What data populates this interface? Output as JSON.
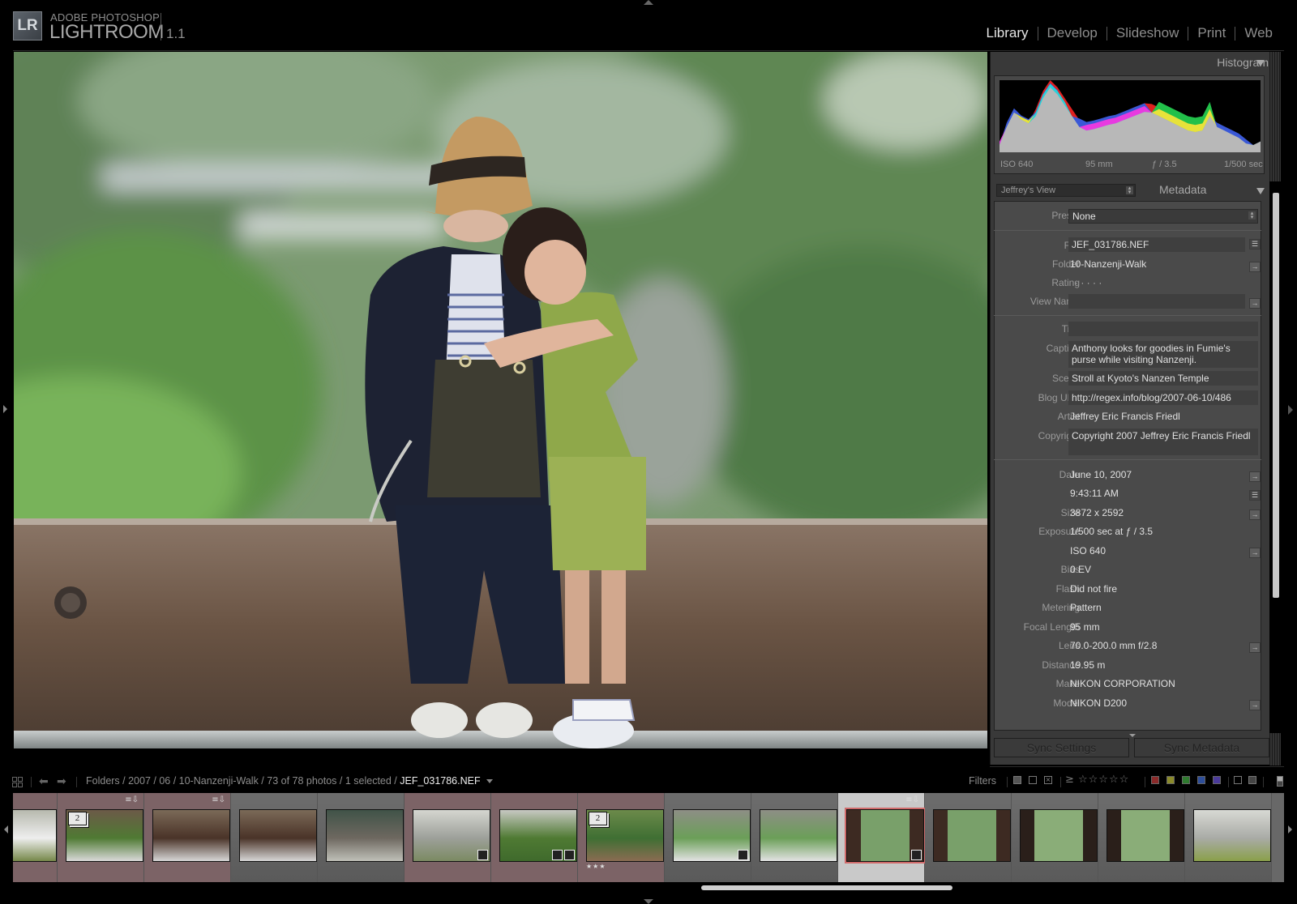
{
  "app": {
    "brand_line1": "ADOBE PHOTOSHOP",
    "brand_line2": "LIGHTROOM",
    "logo": "LR",
    "version": "1.1"
  },
  "modules": [
    {
      "label": "Library",
      "active": true
    },
    {
      "label": "Develop",
      "active": false
    },
    {
      "label": "Slideshow",
      "active": false
    },
    {
      "label": "Print",
      "active": false
    },
    {
      "label": "Web",
      "active": false
    }
  ],
  "photo": {
    "description": "Woman in tan hat and navy cardigan sitting on wooden ledge with boy in green shirt looking into her bag, green trees behind"
  },
  "histogram": {
    "title": "Histogram",
    "iso": "ISO 640",
    "focal": "95 mm",
    "aperture": "ƒ / 3.5",
    "shutter": "1/500 sec",
    "colors": {
      "red": "#e02020",
      "green": "#22c04a",
      "blue": "#3a58d6",
      "yellow": "#e7e23a",
      "magenta": "#e83ae0",
      "cyan": "#2ad0d8",
      "gray": "#b8b8b8"
    }
  },
  "metadata": {
    "title": "Metadata",
    "view_preset": "Jeffrey's View",
    "preset_label": "Preset",
    "preset_value": "None",
    "fields": {
      "file": {
        "label": "File",
        "value": "JEF_031786.NEF"
      },
      "folder": {
        "label": "Folder",
        "value": "10-Nanzenji-Walk"
      },
      "rating": {
        "label": "Rating",
        "value": "·  ·  ·  ·  ·"
      },
      "view_name": {
        "label": "View Name",
        "value": ""
      },
      "title": {
        "label": "Title",
        "value": ""
      },
      "caption": {
        "label": "Caption",
        "value": "Anthony looks for goodies in Fumie's purse while visiting Nanzenji."
      },
      "scene": {
        "label": "Scene",
        "value": "Stroll at Kyoto's Nanzen Temple"
      },
      "blog_url": {
        "label": "Blog URL",
        "value": "http://regex.info/blog/2007-06-10/486"
      },
      "artist": {
        "label": "Artist",
        "value": "Jeffrey Eric Francis Friedl"
      },
      "copyright": {
        "label": "Copyright",
        "value": "Copyright 2007 Jeffrey Eric Francis Friedl"
      },
      "date": {
        "label": "Date",
        "value": "June 10, 2007"
      },
      "time": {
        "label": "",
        "value": "9:43:11 AM"
      },
      "size": {
        "label": "Size",
        "value": "3872 x 2592"
      },
      "exposure": {
        "label": "Exposure",
        "value": "1/500 sec at ƒ / 3.5"
      },
      "iso": {
        "label": "",
        "value": "ISO 640"
      },
      "bias": {
        "label": "Bias",
        "value": "0 EV"
      },
      "flash": {
        "label": "Flash",
        "value": "Did not fire"
      },
      "metering": {
        "label": "Metering",
        "value": "Pattern"
      },
      "focal_length": {
        "label": "Focal Length",
        "value": "95 mm"
      },
      "lens": {
        "label": "Lens",
        "value": "70.0-200.0 mm f/2.8"
      },
      "distance": {
        "label": "Distance",
        "value": "19.95 m"
      },
      "make": {
        "label": "Make",
        "value": "NIKON CORPORATION"
      },
      "model": {
        "label": "Model",
        "value": "NIKON D200"
      }
    }
  },
  "sync": {
    "settings_label": "Sync Settings",
    "metadata_label": "Sync Metadata"
  },
  "filmstrip_bar": {
    "breadcrumb": "Folders / 2007 / 06 / 10-Nanzenji-Walk / 73 of 78 photos / 1 selected / ",
    "current_file": "JEF_031786.NEF",
    "filters_label": "Filters",
    "rating_op": "≥",
    "stars": "☆☆☆☆☆",
    "label_colors": [
      "#8b2a2a",
      "#8a8a2a",
      "#2f7a2f",
      "#2e4e9a",
      "#4a3a9a"
    ]
  },
  "filmstrip": {
    "thumbs": [
      {
        "bg": "pink",
        "stack": "",
        "stars": "",
        "scene": "wall"
      },
      {
        "bg": "pink",
        "stack": "2",
        "stars": "",
        "scene": "temple-green",
        "meta": true
      },
      {
        "bg": "pink",
        "stack": "",
        "stars": "",
        "scene": "temple-brown",
        "meta": true
      },
      {
        "bg": "grey",
        "stack": "",
        "stars": "",
        "scene": "temple-brown"
      },
      {
        "bg": "grey",
        "stack": "",
        "stars": "",
        "scene": "fountain"
      },
      {
        "bg": "pink",
        "stack": "",
        "stars": "",
        "scene": "path",
        "badges": [
          "dev"
        ]
      },
      {
        "bg": "pink",
        "stack": "",
        "stars": "",
        "scene": "path-green",
        "badges": [
          "crop",
          "dev"
        ]
      },
      {
        "bg": "pink",
        "stack": "2",
        "stars": "★★★",
        "scene": "trees"
      },
      {
        "bg": "grey",
        "stack": "",
        "stars": "",
        "scene": "people-green",
        "badges": [
          "crop"
        ]
      },
      {
        "bg": "grey",
        "stack": "",
        "stars": "",
        "scene": "people-green"
      },
      {
        "bg": "sel",
        "stack": "",
        "stars": "",
        "scene": "gate",
        "selected": true,
        "meta": true,
        "badges": [
          "dev"
        ]
      },
      {
        "bg": "grey",
        "stack": "",
        "stars": "",
        "scene": "gate"
      },
      {
        "bg": "grey",
        "stack": "",
        "stars": "",
        "scene": "gate-wide"
      },
      {
        "bg": "grey",
        "stack": "",
        "stars": "",
        "scene": "gate-wide"
      },
      {
        "bg": "grey",
        "stack": "",
        "stars": "",
        "scene": "child"
      }
    ]
  }
}
